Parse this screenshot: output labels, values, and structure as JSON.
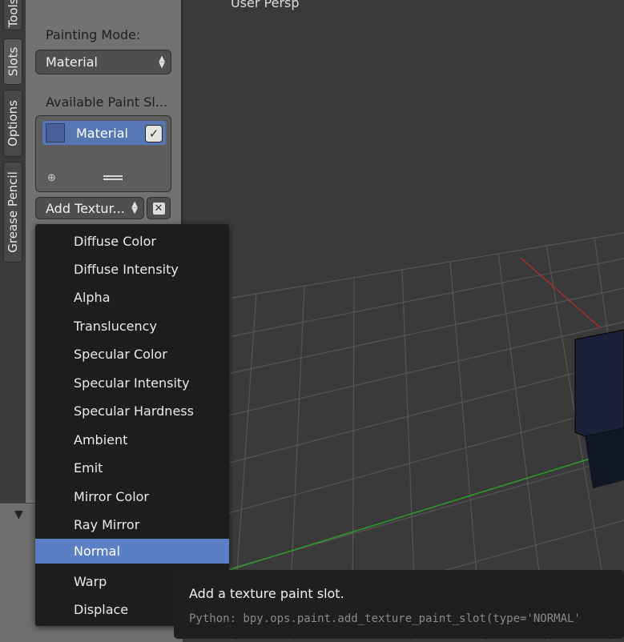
{
  "viewport": {
    "perspective_label": "User Persp"
  },
  "tabs": [
    {
      "label": "Tools"
    },
    {
      "label": "Slots"
    },
    {
      "label": "Options"
    },
    {
      "label": "Grease Pencil"
    }
  ],
  "toolshelf": {
    "painting_mode_label": "Painting Mode:",
    "painting_mode_value": "Material",
    "available_slots_label": "Available Paint Sl...",
    "slots": [
      {
        "name": "Material",
        "checked": true
      }
    ],
    "add_texture_label": "Add Textur...",
    "remove_label": "✕"
  },
  "menu": {
    "items": [
      {
        "label": "Diffuse Color"
      },
      {
        "label": "Diffuse Intensity"
      },
      {
        "label": "Alpha"
      },
      {
        "label": "Translucency"
      },
      {
        "label": "Specular Color"
      },
      {
        "label": "Specular Intensity"
      },
      {
        "label": "Specular Hardness"
      },
      {
        "label": "Ambient"
      },
      {
        "label": "Emit"
      },
      {
        "label": "Mirror Color"
      },
      {
        "label": "Ray Mirror"
      },
      {
        "label": "Normal",
        "highlighted": true
      },
      {
        "label": "Warp"
      },
      {
        "label": "Displace"
      }
    ]
  },
  "tooltip": {
    "title": "Add a texture paint slot.",
    "python": "Python: bpy.ops.paint.add_texture_paint_slot(type='NORMAL'"
  },
  "colors": {
    "highlight": "#5b7fc4",
    "menu_bg": "#1d1d1d",
    "panel_bg": "#727272",
    "viewport_bg": "#3a3a3a",
    "cube": "#1a2138",
    "x_axis": "#a03030",
    "y_axis": "#2e9a2e"
  }
}
